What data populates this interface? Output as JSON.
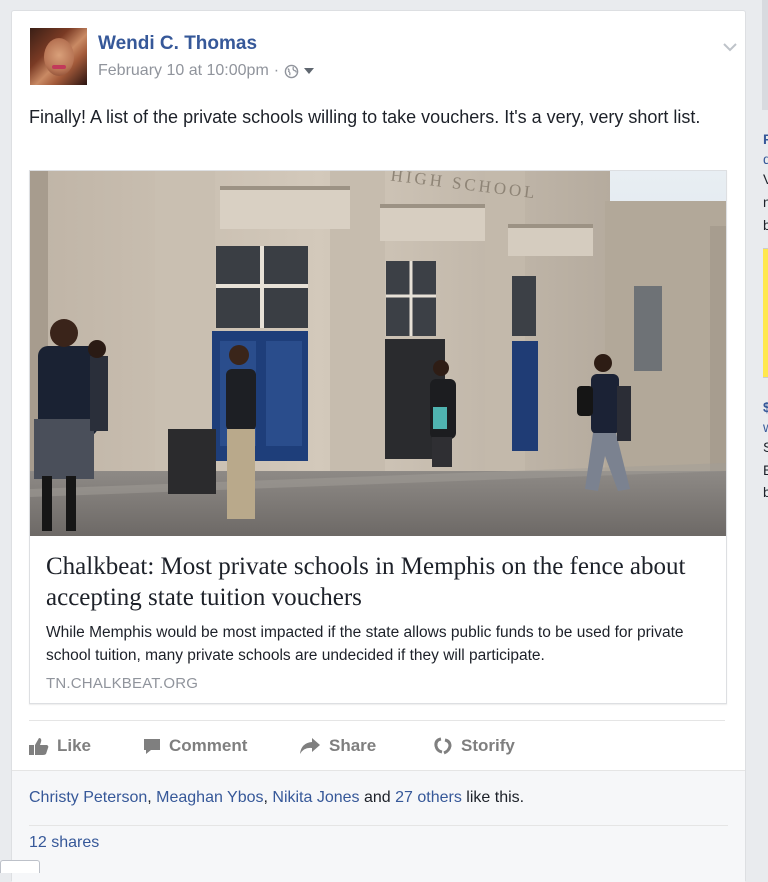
{
  "post": {
    "author": "Wendi C. Thomas",
    "date": "February 10 at 10:00pm",
    "dot": "·",
    "status_text": "Finally! A list of the private schools willing to take vouchers. It's a very, very short list."
  },
  "link_preview": {
    "image_sign": "HIGH SCHOOL",
    "title": "Chalkbeat: Most private schools in Memphis on the fence about accepting state tuition vouchers",
    "description": "While Memphis would be most impacted if the state allows public funds to be used for private school tuition, many private schools are undecided if they will participate.",
    "domain": "TN.CHALKBEAT.ORG"
  },
  "actions": {
    "like": "Like",
    "comment": "Comment",
    "share": "Share",
    "storify": "Storify"
  },
  "reactions": {
    "names": [
      "Christy Peterson",
      "Meaghan Ybos",
      "Nikita Jones"
    ],
    "sep1": ", ",
    "sep2": ", ",
    "and": " and ",
    "others": "27 others",
    "suffix": " like this."
  },
  "shares_count": "12 shares",
  "sidebar": {
    "letters": [
      "F",
      "d",
      "V",
      "n",
      "b",
      "$",
      "w",
      "S",
      "E",
      "b"
    ]
  },
  "icons": {
    "privacy": "globe-icon",
    "audience_dropdown": "caret-down-icon",
    "post_menu": "chevron-down-icon",
    "like": "thumbs-up-icon",
    "comment": "speech-bubble-icon",
    "share": "share-arrow-icon",
    "storify": "storify-icon"
  },
  "colors": {
    "link_blue": "#365899",
    "muted": "#90949c",
    "action_gray": "#7f7f7f",
    "background": "#e9ebee"
  }
}
